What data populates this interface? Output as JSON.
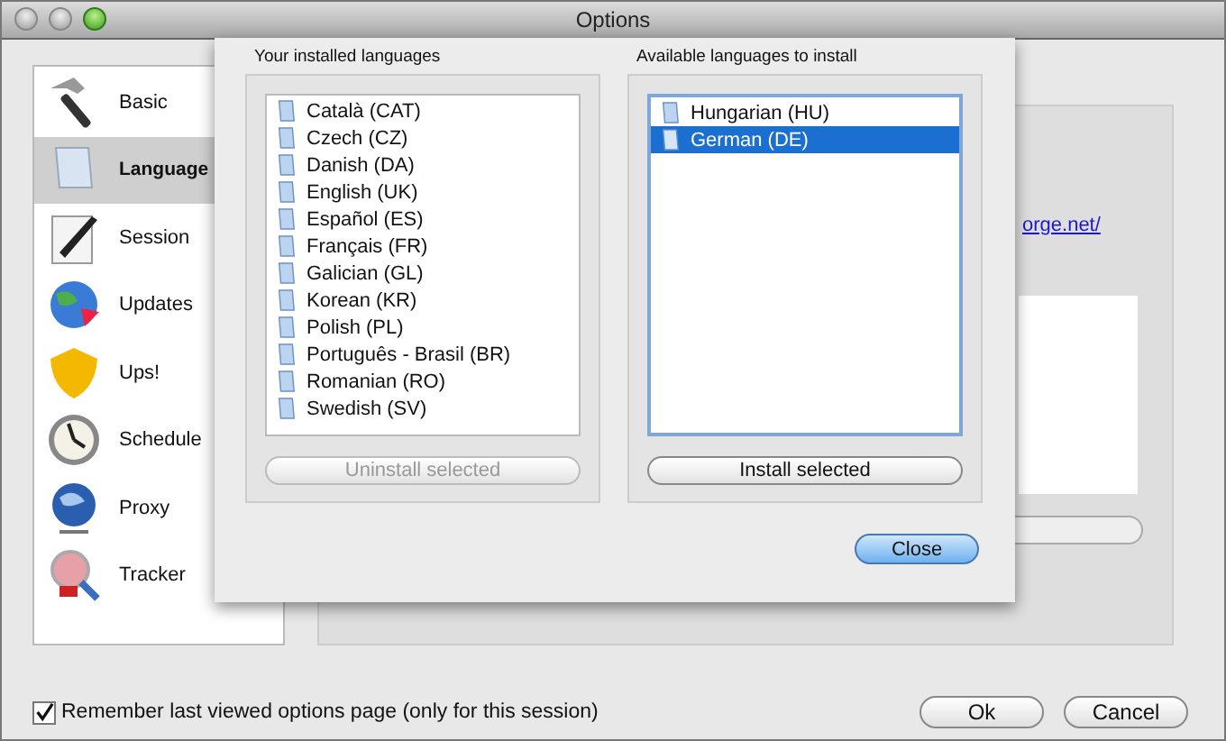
{
  "window": {
    "title": "Options"
  },
  "sidebar": {
    "items": [
      {
        "label": "Basic",
        "selected": false
      },
      {
        "label": "Language",
        "selected": true
      },
      {
        "label": "Session",
        "selected": false
      },
      {
        "label": "Updates",
        "selected": false
      },
      {
        "label": "Ups!",
        "selected": false
      },
      {
        "label": "Schedule",
        "selected": false
      },
      {
        "label": "Proxy",
        "selected": false
      },
      {
        "label": "Tracker",
        "selected": false
      }
    ]
  },
  "background_panel": {
    "link": "orge.net/"
  },
  "sheet": {
    "installed": {
      "title": "Your installed languages",
      "items": [
        {
          "label": "Català (CAT)",
          "selected": false
        },
        {
          "label": "Czech (CZ)",
          "selected": false
        },
        {
          "label": "Danish (DA)",
          "selected": false
        },
        {
          "label": "English (UK)",
          "selected": false
        },
        {
          "label": "Español (ES)",
          "selected": false
        },
        {
          "label": "Français (FR)",
          "selected": false
        },
        {
          "label": "Galician (GL)",
          "selected": false
        },
        {
          "label": "Korean (KR)",
          "selected": false
        },
        {
          "label": "Polish (PL)",
          "selected": false
        },
        {
          "label": "Português - Brasil (BR)",
          "selected": false
        },
        {
          "label": "Romanian (RO)",
          "selected": false
        },
        {
          "label": "Swedish (SV)",
          "selected": false
        }
      ],
      "button": {
        "label": "Uninstall selected",
        "disabled": true
      }
    },
    "available": {
      "title": "Available languages to install",
      "items": [
        {
          "label": "Hungarian (HU)",
          "selected": false
        },
        {
          "label": "German (DE)",
          "selected": true
        }
      ],
      "button": {
        "label": "Install selected",
        "disabled": false
      }
    },
    "close_button": "Close"
  },
  "remember": {
    "label": "Remember last viewed options page (only for this session)",
    "checked": true
  },
  "buttons": [
    "Ok",
    "Cancel"
  ]
}
